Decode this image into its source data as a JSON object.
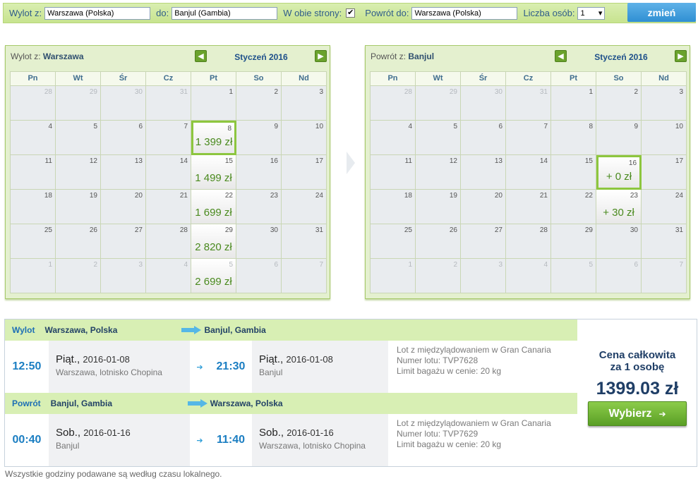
{
  "search": {
    "from_label": "Wylot z:",
    "from_value": "Warszawa (Polska)",
    "to_label": "do:",
    "to_value": "Banjul (Gambia)",
    "round_trip_label": "W obie strony:",
    "round_trip_checked": "✔",
    "return_label": "Powrót do:",
    "return_value": "Warszawa (Polska)",
    "persons_label": "Liczba osób:",
    "persons_value": "1",
    "change_button": "zmień"
  },
  "cal_out": {
    "title_prefix": "Wylot z:",
    "title_city": "Warszawa",
    "month": "Styczeń 2016",
    "weekdays": [
      "Pn",
      "Wt",
      "Śr",
      "Cz",
      "Pt",
      "So",
      "Nd"
    ],
    "rows": [
      [
        {
          "d": "28",
          "o": 1
        },
        {
          "d": "29",
          "o": 1
        },
        {
          "d": "30",
          "o": 1
        },
        {
          "d": "31",
          "o": 1
        },
        {
          "d": "1"
        },
        {
          "d": "2"
        },
        {
          "d": "3"
        }
      ],
      [
        {
          "d": "4"
        },
        {
          "d": "5"
        },
        {
          "d": "6"
        },
        {
          "d": "7"
        },
        {
          "d": "8",
          "p": "1 399 zł",
          "s": 1
        },
        {
          "d": "9"
        },
        {
          "d": "10"
        }
      ],
      [
        {
          "d": "11"
        },
        {
          "d": "12"
        },
        {
          "d": "13"
        },
        {
          "d": "14"
        },
        {
          "d": "15",
          "p": "1 499 zł"
        },
        {
          "d": "16"
        },
        {
          "d": "17"
        }
      ],
      [
        {
          "d": "18"
        },
        {
          "d": "19"
        },
        {
          "d": "20"
        },
        {
          "d": "21"
        },
        {
          "d": "22",
          "p": "1 699 zł"
        },
        {
          "d": "23"
        },
        {
          "d": "24"
        }
      ],
      [
        {
          "d": "25"
        },
        {
          "d": "26"
        },
        {
          "d": "27"
        },
        {
          "d": "28"
        },
        {
          "d": "29",
          "p": "2 820 zł"
        },
        {
          "d": "30"
        },
        {
          "d": "31"
        }
      ],
      [
        {
          "d": "1",
          "o": 1
        },
        {
          "d": "2",
          "o": 1
        },
        {
          "d": "3",
          "o": 1
        },
        {
          "d": "4",
          "o": 1
        },
        {
          "d": "5",
          "o": 1,
          "p": "2 699 zł"
        },
        {
          "d": "6",
          "o": 1
        },
        {
          "d": "7",
          "o": 1
        }
      ]
    ]
  },
  "cal_ret": {
    "title_prefix": "Powrót z:",
    "title_city": "Banjul",
    "month": "Styczeń 2016",
    "weekdays": [
      "Pn",
      "Wt",
      "Śr",
      "Cz",
      "Pt",
      "So",
      "Nd"
    ],
    "rows": [
      [
        {
          "d": "28",
          "o": 1
        },
        {
          "d": "29",
          "o": 1
        },
        {
          "d": "30",
          "o": 1
        },
        {
          "d": "31",
          "o": 1
        },
        {
          "d": "1"
        },
        {
          "d": "2"
        },
        {
          "d": "3"
        }
      ],
      [
        {
          "d": "4"
        },
        {
          "d": "5"
        },
        {
          "d": "6"
        },
        {
          "d": "7"
        },
        {
          "d": "8"
        },
        {
          "d": "9"
        },
        {
          "d": "10"
        }
      ],
      [
        {
          "d": "11"
        },
        {
          "d": "12"
        },
        {
          "d": "13"
        },
        {
          "d": "14"
        },
        {
          "d": "15"
        },
        {
          "d": "16",
          "p": "+ 0 zł",
          "s": 1
        },
        {
          "d": "17"
        }
      ],
      [
        {
          "d": "18"
        },
        {
          "d": "19"
        },
        {
          "d": "20"
        },
        {
          "d": "21"
        },
        {
          "d": "22"
        },
        {
          "d": "23",
          "p": "+ 30 zł"
        },
        {
          "d": "24"
        }
      ],
      [
        {
          "d": "25"
        },
        {
          "d": "26"
        },
        {
          "d": "27"
        },
        {
          "d": "28"
        },
        {
          "d": "29"
        },
        {
          "d": "30"
        },
        {
          "d": "31"
        }
      ],
      [
        {
          "d": "1",
          "o": 1
        },
        {
          "d": "2",
          "o": 1
        },
        {
          "d": "3",
          "o": 1
        },
        {
          "d": "4",
          "o": 1
        },
        {
          "d": "5",
          "o": 1
        },
        {
          "d": "6",
          "o": 1
        },
        {
          "d": "7",
          "o": 1
        }
      ]
    ]
  },
  "outbound": {
    "label": "Wylot",
    "from": "Warszawa, Polska",
    "to": "Banjul, Gambia",
    "dep_time": "12:50",
    "dep_day": "Piąt.,",
    "dep_date": "2016-01-08",
    "dep_place": "Warszawa, lotnisko Chopina",
    "arr_time": "21:30",
    "arr_day": "Piąt.,",
    "arr_date": "2016-01-08",
    "arr_place": "Banjul",
    "detail1": "Lot z międzylądowaniem w Gran Canaria",
    "detail2": "Numer lotu: TVP7628",
    "detail3": "Limit bagażu w cenie: 20 kg"
  },
  "return": {
    "label": "Powrót",
    "from": "Banjul, Gambia",
    "to": "Warszawa, Polska",
    "dep_time": "00:40",
    "dep_day": "Sob.,",
    "dep_date": "2016-01-16",
    "dep_place": "Banjul",
    "arr_time": "11:40",
    "arr_day": "Sob.,",
    "arr_date": "2016-01-16",
    "arr_place": "Warszawa, lotnisko Chopina",
    "detail1": "Lot z międzylądowaniem w Gran Canaria",
    "detail2": "Numer lotu: TVP7629",
    "detail3": "Limit bagażu w cenie: 20 kg"
  },
  "price": {
    "label_line1": "Cena całkowita",
    "label_line2": "za 1 osobę",
    "amount": "1399.03 zł",
    "select_button": "Wybierz"
  },
  "footer_note": "Wszystkie godziny podawane są według czasu lokalnego."
}
